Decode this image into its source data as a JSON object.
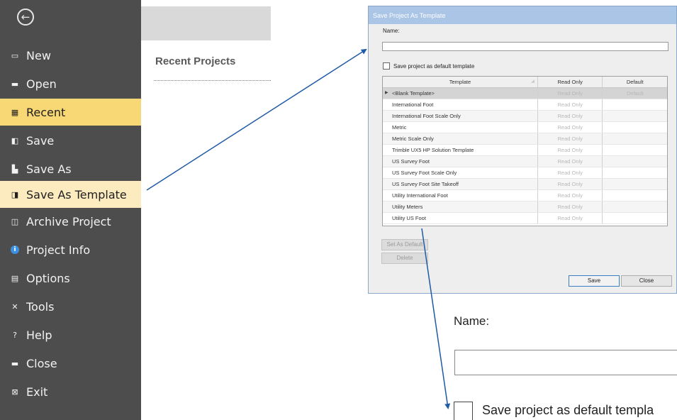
{
  "sidebar": {
    "items": [
      {
        "label": "New",
        "icon": "new-icon",
        "glyph": "▭"
      },
      {
        "label": "Open",
        "icon": "open-folder-icon",
        "glyph": "▬"
      },
      {
        "label": "Recent",
        "icon": "recent-icon",
        "glyph": "▦"
      },
      {
        "label": "Save",
        "icon": "save-icon",
        "glyph": "◧"
      },
      {
        "label": "Save As",
        "icon": "save-as-icon",
        "glyph": "▙"
      },
      {
        "label": "Save As Template",
        "icon": "save-as-template-icon",
        "glyph": "◨"
      },
      {
        "label": "Archive Project",
        "icon": "archive-icon",
        "glyph": "◫"
      },
      {
        "label": "Project Info",
        "icon": "info-icon",
        "glyph": "i"
      },
      {
        "label": "Options",
        "icon": "options-icon",
        "glyph": "▤"
      },
      {
        "label": "Tools",
        "icon": "tools-icon",
        "glyph": "✕"
      },
      {
        "label": "Help",
        "icon": "help-icon",
        "glyph": "?"
      },
      {
        "label": "Close",
        "icon": "close-icon",
        "glyph": "▬"
      },
      {
        "label": "Exit",
        "icon": "exit-icon",
        "glyph": "⊠"
      }
    ]
  },
  "content": {
    "recent_title": "Recent Projects"
  },
  "dialog": {
    "title": "Save Project As Template",
    "name_label": "Name:",
    "name_value": "",
    "checkbox_label": "Save project as default template",
    "grid": {
      "headers": [
        "Template",
        "Read Only",
        "Default"
      ],
      "rows": [
        {
          "template": "<Blank Template>",
          "read_only": "Read Only",
          "default": "Default"
        },
        {
          "template": "International Foot",
          "read_only": "Read Only",
          "default": ""
        },
        {
          "template": "International Foot Scale Only",
          "read_only": "Read Only",
          "default": ""
        },
        {
          "template": "Metric",
          "read_only": "Read Only",
          "default": ""
        },
        {
          "template": "Metric Scale Only",
          "read_only": "Read Only",
          "default": ""
        },
        {
          "template": "Trimble UX5 HP Solution Template",
          "read_only": "Read Only",
          "default": ""
        },
        {
          "template": "US Survey Foot",
          "read_only": "Read Only",
          "default": ""
        },
        {
          "template": "US Survey Foot Scale Only",
          "read_only": "Read Only",
          "default": ""
        },
        {
          "template": "US Survey Foot Site Takeoff",
          "read_only": "Read Only",
          "default": ""
        },
        {
          "template": "Utility International Foot",
          "read_only": "Read Only",
          "default": ""
        },
        {
          "template": "Utility Meters",
          "read_only": "Read Only",
          "default": ""
        },
        {
          "template": "Utility US Foot",
          "read_only": "Read Only",
          "default": ""
        }
      ]
    },
    "buttons": {
      "set_default": "Set As Default",
      "delete": "Delete",
      "save": "Save",
      "close": "Close"
    }
  },
  "zoom": {
    "name_label": "Name:",
    "checkbox_label": "Save project as default templa"
  },
  "colors": {
    "sidebar_bg": "#4d4d4d",
    "recent_highlight": "#f8d775",
    "template_highlight": "#fdebc0",
    "arrow": "#1f5aa6"
  }
}
